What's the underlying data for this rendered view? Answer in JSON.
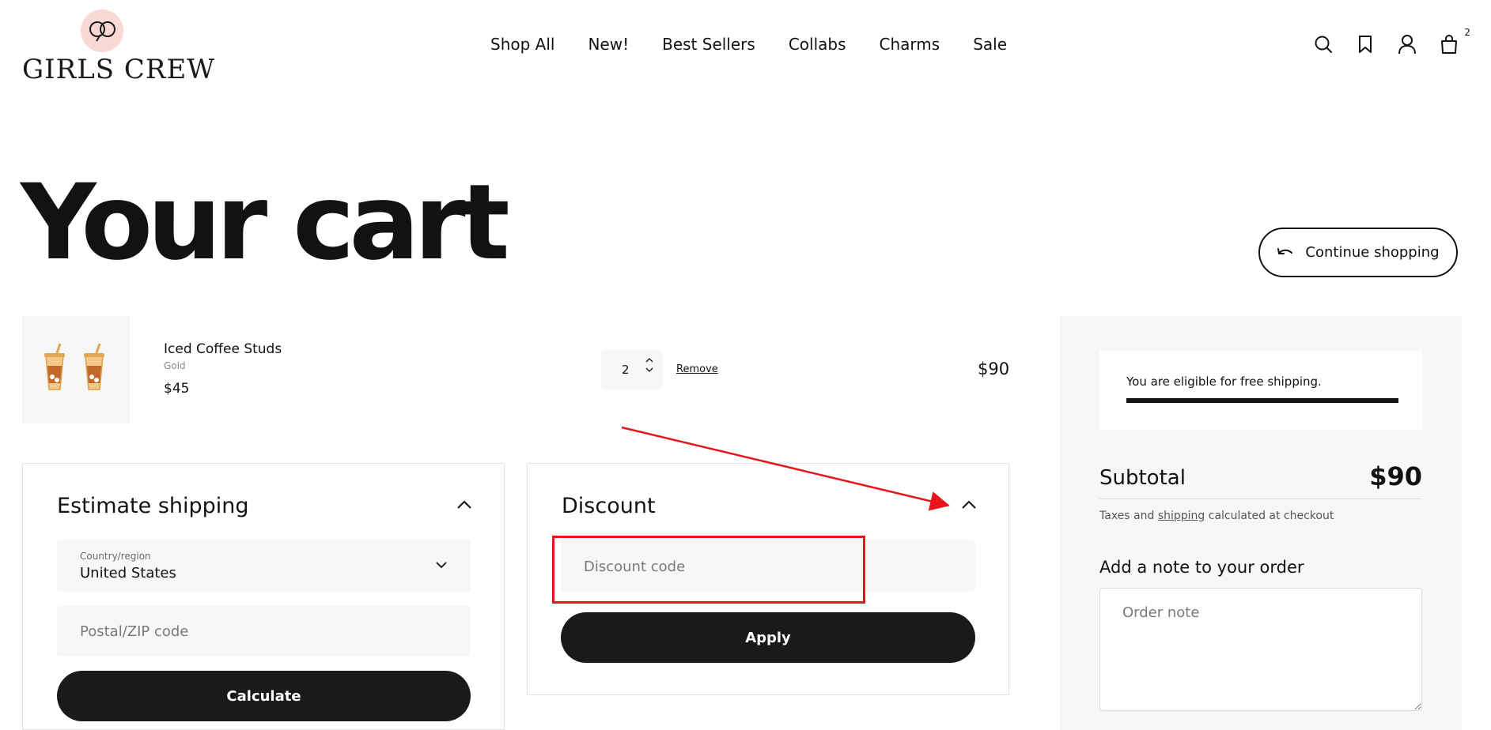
{
  "brand": {
    "name": "GIRLS CREW",
    "logo_icon": "rings-icon",
    "logo_color": "#f9d9d6"
  },
  "nav": {
    "items": [
      {
        "label": "Shop All"
      },
      {
        "label": "New!"
      },
      {
        "label": "Best Sellers"
      },
      {
        "label": "Collabs"
      },
      {
        "label": "Charms"
      },
      {
        "label": "Sale"
      }
    ]
  },
  "header_icons": {
    "search": "search-icon",
    "wishlist": "bookmark-icon",
    "account": "user-icon",
    "cart": "bag-icon",
    "cart_count": "2"
  },
  "page": {
    "title": "Your cart",
    "continue_label": "Continue shopping"
  },
  "cart": {
    "items": [
      {
        "name": "Iced Coffee Studs",
        "variant": "Gold",
        "price": "$45",
        "quantity": "2",
        "remove_label": "Remove",
        "line_total": "$90"
      }
    ]
  },
  "shipping": {
    "title": "Estimate shipping",
    "country_label": "Country/region",
    "country_value": "United States",
    "zip_placeholder": "Postal/ZIP code",
    "calculate_label": "Calculate"
  },
  "discount": {
    "title": "Discount",
    "code_placeholder": "Discount code",
    "apply_label": "Apply"
  },
  "summary": {
    "free_shipping_text": "You are eligible for free shipping.",
    "free_shipping_progress": 1.0,
    "subtotal_label": "Subtotal",
    "subtotal_value": "$90",
    "tax_before": "Taxes and ",
    "tax_link": "shipping",
    "tax_after": " calculated at checkout",
    "note_title": "Add a note to your order",
    "note_placeholder": "Order note"
  },
  "colors": {
    "annotation": "#e8161b",
    "button_dark": "#1a1a1a",
    "panel_bg": "#f7f7f7"
  }
}
